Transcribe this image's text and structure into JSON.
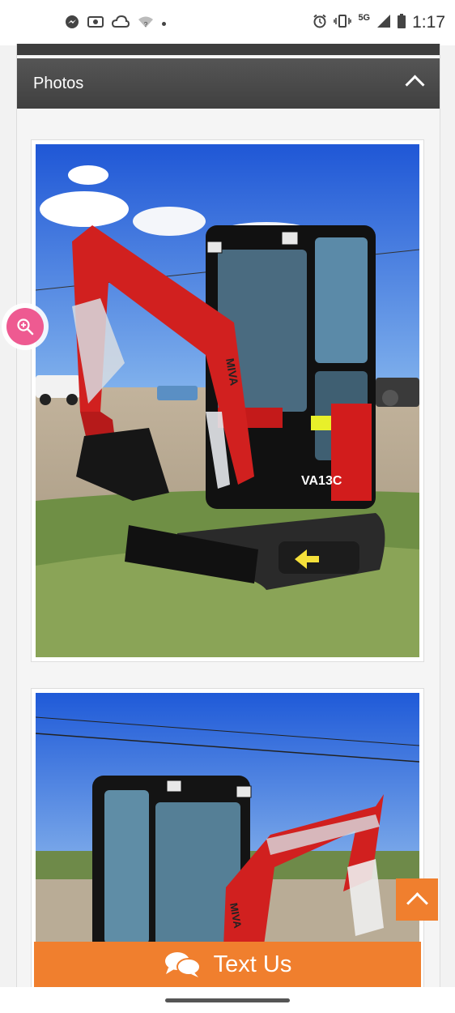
{
  "status_bar": {
    "time": "1:17",
    "network": "5G",
    "icons_left": [
      "messenger-icon",
      "photo-icon",
      "cloud-icon",
      "wifi-icon"
    ],
    "icons_right": [
      "alarm-icon",
      "vibrate-icon",
      "signal-icon",
      "battery-icon"
    ]
  },
  "section": {
    "title": "Photos",
    "toggle_icon": "chevron-up-icon"
  },
  "photos": [
    {
      "subject": "red excavator front view",
      "decal_brand": "MIVA",
      "decal_model": "VA13C"
    },
    {
      "subject": "red excavator rear view",
      "decal_brand": "MIVA"
    }
  ],
  "buttons": {
    "zoom_icon": "zoom-in-icon",
    "scroll_top_icon": "chevron-up-icon",
    "text_us_label": "Text Us",
    "text_us_icon": "chat-bubbles-icon"
  },
  "colors": {
    "accent": "#f07f2e",
    "header": "#4a4a4a",
    "zoom": "#ee5a91"
  }
}
